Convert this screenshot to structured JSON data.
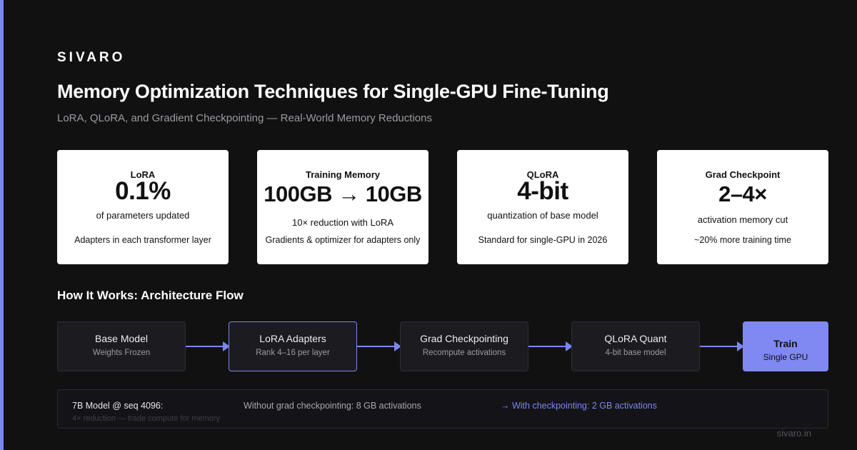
{
  "brand": "SIVARO",
  "title": "Memory Optimization Techniques for Single-GPU Fine-Tuning",
  "subtitle": "LoRA, QLoRA, and Gradient Checkpointing — Real-World Memory Reductions",
  "stats": [
    {
      "label": "LoRA",
      "value": "0.1%",
      "desc": "of parameters updated",
      "note": "Adapters in each transformer layer"
    },
    {
      "label": "Training Memory",
      "value": "100GB → 10GB",
      "desc": "10× reduction with LoRA",
      "note": "Gradients & optimizer for adapters only"
    },
    {
      "label": "QLoRA",
      "value": "4-bit",
      "desc": "quantization of base model",
      "note": "Standard for single-GPU in 2026"
    },
    {
      "label": "Grad Checkpoint",
      "value": "2–4×",
      "desc": "activation memory cut",
      "note": "~20% more training time"
    }
  ],
  "section_title": "How It Works: Architecture Flow",
  "flow": [
    {
      "title": "Base Model",
      "sub": "Weights Frozen"
    },
    {
      "title": "LoRA Adapters",
      "sub": "Rank 4–16 per layer"
    },
    {
      "title": "Grad Checkpointing",
      "sub": "Recompute activations"
    },
    {
      "title": "QLoRA Quant",
      "sub": "4-bit base model"
    },
    {
      "title": "Train",
      "sub": "Single GPU"
    }
  ],
  "info": {
    "label": "7B Model @ seq 4096:",
    "without": "Without grad checkpointing: 8 GB activations",
    "with": "→ With checkpointing: 2 GB activations",
    "foot": "4× reduction — trade compute for memory"
  },
  "footer_url": "sivaro.in",
  "colors": {
    "accent": "#7b86f2",
    "background": "#111111",
    "card": "#ffffff"
  }
}
